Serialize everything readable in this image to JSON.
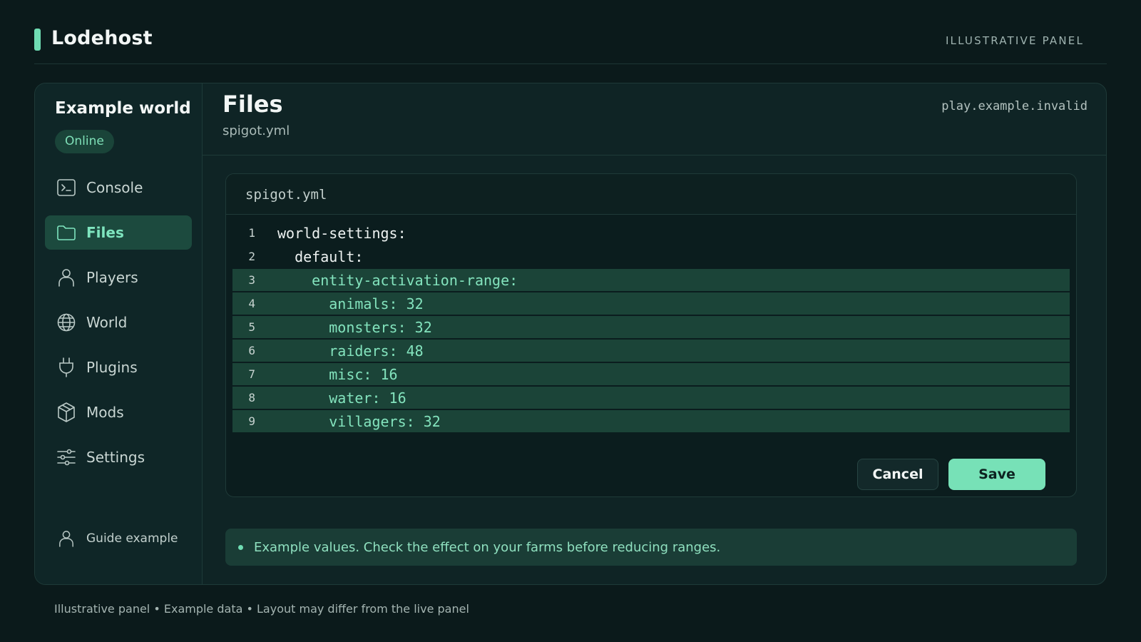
{
  "app": {
    "brand": "Lodehost",
    "tag": "ILLUSTRATIVE PANEL"
  },
  "colors": {
    "accent": "#6fdcb3",
    "background": "#0b1a1b",
    "highlight": "#1b4438"
  },
  "sidebar": {
    "world_name": "Example world",
    "status": "Online",
    "items": [
      {
        "label": "Console",
        "icon": "terminal-icon"
      },
      {
        "label": "Files",
        "icon": "folder-icon",
        "active": true
      },
      {
        "label": "Players",
        "icon": "user-icon"
      },
      {
        "label": "World",
        "icon": "globe-icon"
      },
      {
        "label": "Plugins",
        "icon": "plug-icon"
      },
      {
        "label": "Mods",
        "icon": "box-icon"
      },
      {
        "label": "Settings",
        "icon": "sliders-icon"
      }
    ],
    "guide": {
      "label": "Guide example",
      "icon": "user-icon"
    }
  },
  "main": {
    "title": "Files",
    "subtitle": "spigot.yml",
    "host": "play.example.invalid"
  },
  "editor": {
    "filename": "spigot.yml",
    "lines": [
      {
        "n": "1",
        "text": "world-settings:",
        "highlighted": false
      },
      {
        "n": "2",
        "text": "  default:",
        "highlighted": false
      },
      {
        "n": "3",
        "text": "    entity-activation-range:",
        "highlighted": true
      },
      {
        "n": "4",
        "text": "      animals: 32",
        "highlighted": true
      },
      {
        "n": "5",
        "text": "      monsters: 32",
        "highlighted": true
      },
      {
        "n": "6",
        "text": "      raiders: 48",
        "highlighted": true
      },
      {
        "n": "7",
        "text": "      misc: 16",
        "highlighted": true
      },
      {
        "n": "8",
        "text": "      water: 16",
        "highlighted": true
      },
      {
        "n": "9",
        "text": "      villagers: 32",
        "highlighted": true
      }
    ],
    "cancel_label": "Cancel",
    "save_label": "Save"
  },
  "notice": "Example values. Check the effect on your farms before reducing ranges.",
  "footer": "Illustrative panel • Example data • Layout may differ from the live panel"
}
